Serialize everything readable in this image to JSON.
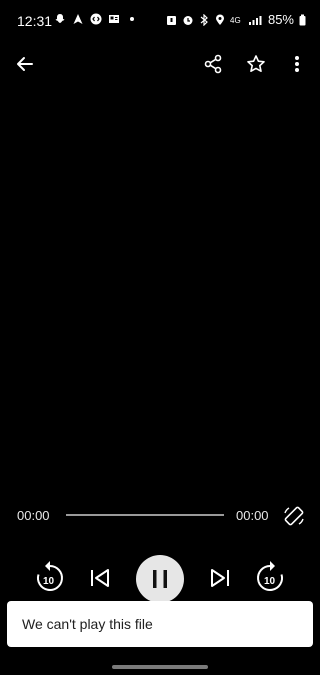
{
  "status_bar": {
    "time": "12:31",
    "battery": "85%",
    "left_icons": [
      "snapchat-icon",
      "navigation-icon",
      "shazam-icon",
      "news-icon",
      "dot-icon"
    ],
    "right_icons": [
      "alarm-icon",
      "alarm-clock-icon",
      "bluetooth-icon",
      "location-icon",
      "lte-icon",
      "signal-icon",
      "battery-icon"
    ],
    "network": "4G"
  },
  "toolbar": {
    "back_icon": "arrow-back-icon",
    "share_icon": "share-icon",
    "star_icon": "star-outline-icon",
    "more_icon": "more-vert-icon"
  },
  "player": {
    "current_time": "00:00",
    "duration": "00:00",
    "progress": 0,
    "rewind_seconds": "10",
    "forward_seconds": "10",
    "state": "playing"
  },
  "snackbar": {
    "message": "We can't play this file"
  },
  "colors": {
    "background": "#000000",
    "snackbar_bg": "#ffffff",
    "pause_button_bg": "#e6e6e6"
  }
}
